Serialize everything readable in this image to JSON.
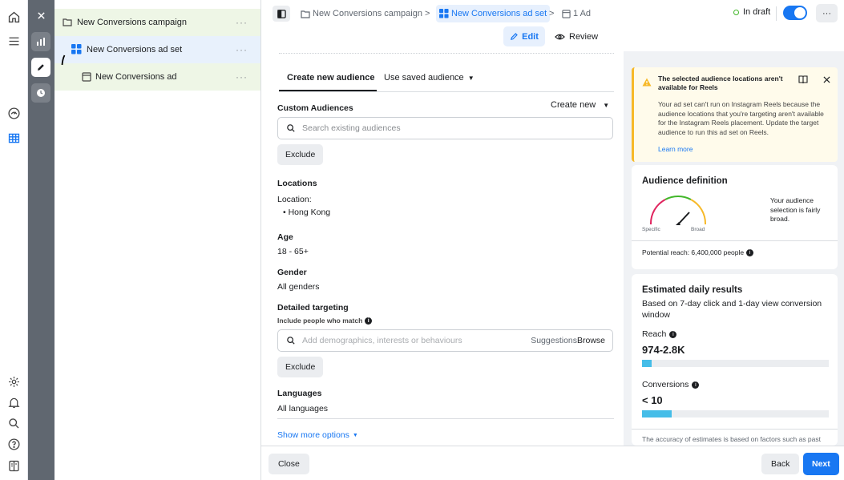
{
  "rail": {
    "icons": [
      "home-icon",
      "menu-icon",
      "dashboard-icon",
      "table-icon",
      "settings-icon",
      "bell-icon",
      "search-icon",
      "help-icon",
      "reports-icon"
    ]
  },
  "tree": {
    "campaign": "New Conversions campaign",
    "adset": "New Conversions ad set",
    "ad": "New Conversions ad",
    "dots": "···"
  },
  "topbar": {
    "crumb_campaign": "New Conversions campaign",
    "crumb_adset": "New Conversions ad set",
    "crumb_ad": "1 Ad",
    "sep": ">",
    "status": "In draft",
    "more": "···",
    "edit": "Edit",
    "review": "Review"
  },
  "form": {
    "tab_create": "Create new audience",
    "tab_saved": "Use saved audience",
    "custom_audiences": "Custom Audiences",
    "create_new": "Create new",
    "search_placeholder": "Search existing audiences",
    "exclude": "Exclude",
    "locations": "Locations",
    "location_label": "Location:",
    "location_value": "• Hong Kong",
    "age": "Age",
    "age_value": "18 - 65+",
    "gender": "Gender",
    "gender_value": "All genders",
    "detailed": "Detailed targeting",
    "detailed_sub": "Include people who match",
    "detailed_placeholder": "Add demographics, interests or behaviours",
    "suggestions": "Suggestions",
    "browse": "Browse",
    "exclude2": "Exclude",
    "languages": "Languages",
    "languages_value": "All languages",
    "show_more": "Show more options"
  },
  "warning": {
    "title": "The selected audience locations aren't available for Reels",
    "body": "Your ad set can't run on Instagram Reels because the audience locations that you're targeting aren't available for the Instagram Reels placement. Update the target audience to run this ad set on Reels.",
    "link": "Learn more"
  },
  "audience": {
    "title": "Audience definition",
    "specific": "Specific",
    "broad": "Broad",
    "desc": "Your audience selection is fairly broad.",
    "reach": "Potential reach: 6,400,000 people"
  },
  "estimates": {
    "title": "Estimated daily results",
    "subtitle": "Based on 7-day click and 1-day view conversion window",
    "reach_label": "Reach",
    "reach_value": "974-2.8K",
    "reach_fill": 0.05,
    "conv_label": "Conversions",
    "conv_value": "< 10",
    "conv_fill": 0.16,
    "footnote": "The accuracy of estimates is based on factors such as past"
  },
  "bottom": {
    "close": "Close",
    "back": "Back",
    "next": "Next"
  },
  "colors": {
    "accent": "#1877f2",
    "draft_dot": "#42b72a",
    "warning": "#f7b928",
    "bar_fill": "#45bde8"
  }
}
